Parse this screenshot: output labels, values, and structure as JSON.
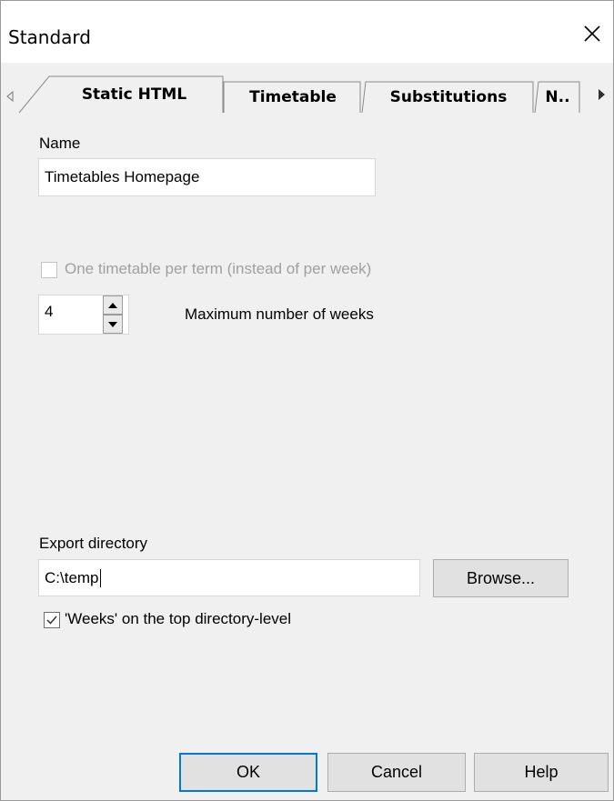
{
  "window": {
    "title": "Standard",
    "close_icon": "close-icon"
  },
  "tabs": {
    "items": [
      {
        "label": "Static HTML",
        "selected": true
      },
      {
        "label": "Timetable",
        "selected": false
      },
      {
        "label": "Substitutions",
        "selected": false
      },
      {
        "label": "N..",
        "selected": false
      }
    ],
    "scroll_left_icon": "triangle-left-icon",
    "scroll_right_icon": "triangle-right-icon"
  },
  "form": {
    "name_label": "Name",
    "name_value": "Timetables Homepage",
    "term_checkbox_label": "One timetable per term (instead of per week)",
    "term_checkbox_checked": false,
    "term_checkbox_enabled": false,
    "weeks_value": "4",
    "weeks_label": "Maximum number of weeks",
    "export_label": "Export directory",
    "export_value": "C:\\temp",
    "browse_label": "Browse...",
    "weeks_top_label": "'Weeks' on the top directory-level",
    "weeks_top_checked": true
  },
  "footer": {
    "ok_label": "OK",
    "cancel_label": "Cancel",
    "help_label": "Help"
  },
  "colors": {
    "accent": "#0078d7",
    "dialog_bg": "#f0f0f0",
    "disabled_text": "#a0a0a0"
  }
}
